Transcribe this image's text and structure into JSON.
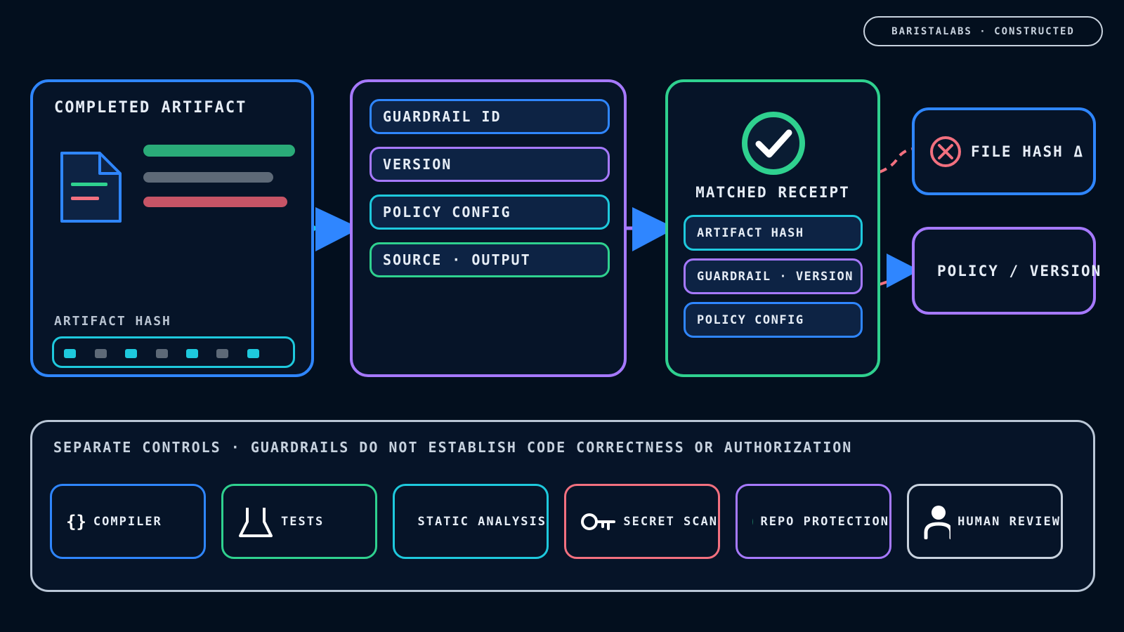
{
  "badge": "BARISTALABS · CONSTRUCTED",
  "artifact": {
    "title": "COMPLETED ARTIFACT",
    "hash_label": "ARTIFACT HASH"
  },
  "fields": [
    {
      "label": "GUARDRAIL ID",
      "color": "#2f86ff"
    },
    {
      "label": "VERSION",
      "color": "#a679ff"
    },
    {
      "label": "POLICY CONFIG",
      "color": "#1ec9dd"
    },
    {
      "label": "SOURCE · OUTPUT",
      "color": "#2fd18f"
    }
  ],
  "receipt": {
    "title": "MATCHED RECEIPT",
    "fields": [
      {
        "label": "ARTIFACT HASH",
        "color": "#1ec9dd"
      },
      {
        "label": "GUARDRAIL · VERSION",
        "color": "#a679ff"
      },
      {
        "label": "POLICY CONFIG",
        "color": "#2f86ff"
      }
    ]
  },
  "mismatches": [
    {
      "label": "FILE HASH Δ",
      "icon": "x-circle-icon"
    },
    {
      "label": "POLICY / VERSION",
      "icon": "x-circle-icon"
    }
  ],
  "controls": {
    "title": "SEPARATE CONTROLS · GUARDRAILS DO NOT ESTABLISH CODE CORRECTNESS OR AUTHORIZATION",
    "items": [
      {
        "label": "COMPILER",
        "icon": "braces-icon",
        "color": "#2f86ff"
      },
      {
        "label": "TESTS",
        "icon": "flask-icon",
        "color": "#2fd18f"
      },
      {
        "label": "STATIC ANALYSIS",
        "icon": "plus-circle-icon",
        "color": "#1ec9dd"
      },
      {
        "label": "SECRET SCAN",
        "icon": "key-icon",
        "color": "#f2707f"
      },
      {
        "label": "REPO PROTECTION",
        "icon": "branch-icon",
        "color": "#a679ff"
      },
      {
        "label": "HUMAN REVIEW",
        "icon": "person-icon",
        "color": "#c8d2de"
      }
    ]
  },
  "colors": {
    "blue": "#2f86ff",
    "purple": "#a679ff",
    "green": "#2fd18f",
    "cyan": "#1ec9dd",
    "red": "#f2707f",
    "background": "#030f1e"
  }
}
